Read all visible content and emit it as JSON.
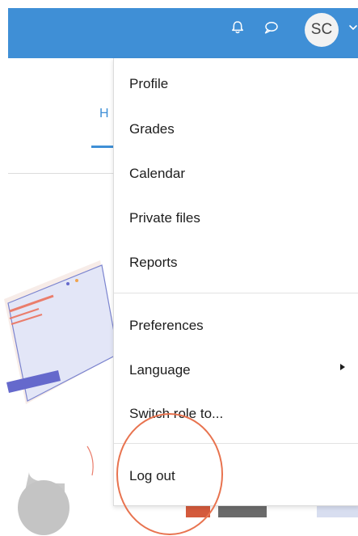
{
  "navbar": {
    "bell_icon": "bell-icon",
    "chat_icon": "chat-bubble-icon",
    "user_initials": "SC",
    "menu_chevron_icon": "chevron-down-icon"
  },
  "page": {
    "tab_partial_label": "H"
  },
  "user_menu": {
    "items": [
      {
        "label": "Profile"
      },
      {
        "label": "Grades"
      },
      {
        "label": "Calendar"
      },
      {
        "label": "Private files"
      },
      {
        "label": "Reports"
      },
      {
        "label": "Preferences"
      },
      {
        "label": "Language",
        "has_submenu": true
      },
      {
        "label": "Switch role to..."
      },
      {
        "label": "Log out",
        "highlighted": true
      }
    ]
  },
  "colors": {
    "navbar": "#3f8fd6",
    "highlight_circle": "#e8734f"
  }
}
